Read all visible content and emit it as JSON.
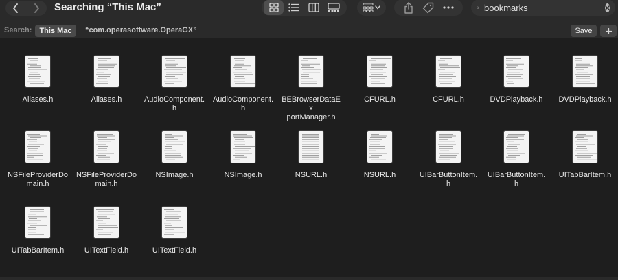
{
  "window": {
    "title": "Searching “This Mac”"
  },
  "toolbar": {
    "view_modes": [
      {
        "icon": "icon-view-icon",
        "active": true
      },
      {
        "icon": "list-view-icon",
        "active": false
      },
      {
        "icon": "column-view-icon",
        "active": false
      },
      {
        "icon": "gallery-view-icon",
        "active": false
      }
    ],
    "group_icon": "group-by-icon",
    "actions": [
      "share-icon",
      "tag-icon",
      "more-icon"
    ]
  },
  "search": {
    "value": "bookmarks"
  },
  "scope": {
    "label": "Search:",
    "active": "This Mac",
    "folder": "“com.operasoftware.OperaGX”",
    "save_label": "Save",
    "add_label": "+"
  },
  "files": [
    {
      "line1": "Aliases.h",
      "line2": ""
    },
    {
      "line1": "Aliases.h",
      "line2": ""
    },
    {
      "line1": "AudioComponent.",
      "line2": "h"
    },
    {
      "line1": "AudioComponent.",
      "line2": "h"
    },
    {
      "line1": "BEBrowserDataEx",
      "line2": "portManager.h"
    },
    {
      "line1": "CFURL.h",
      "line2": ""
    },
    {
      "line1": "CFURL.h",
      "line2": ""
    },
    {
      "line1": "DVDPlayback.h",
      "line2": ""
    },
    {
      "line1": "DVDPlayback.h",
      "line2": ""
    },
    {
      "line1": "NSFileProviderDo",
      "line2": "main.h"
    },
    {
      "line1": "NSFileProviderDo",
      "line2": "main.h"
    },
    {
      "line1": "NSImage.h",
      "line2": ""
    },
    {
      "line1": "NSImage.h",
      "line2": ""
    },
    {
      "line1": "NSURL.h",
      "line2": ""
    },
    {
      "line1": "NSURL.h",
      "line2": ""
    },
    {
      "line1": "UIBarButtonItem.",
      "line2": "h"
    },
    {
      "line1": "UIBarButtonItem.",
      "line2": "h"
    },
    {
      "line1": "UITabBarItem.h",
      "line2": ""
    },
    {
      "line1": "UITabBarItem.h",
      "line2": ""
    },
    {
      "line1": "UITextField.h",
      "line2": ""
    },
    {
      "line1": "UITextField.h",
      "line2": ""
    }
  ],
  "colors": {
    "window_bg": "#1e1e1e",
    "toolbar_bg": "#2a2a2a",
    "control_bg": "#333333",
    "text": "#e8e8e8"
  }
}
